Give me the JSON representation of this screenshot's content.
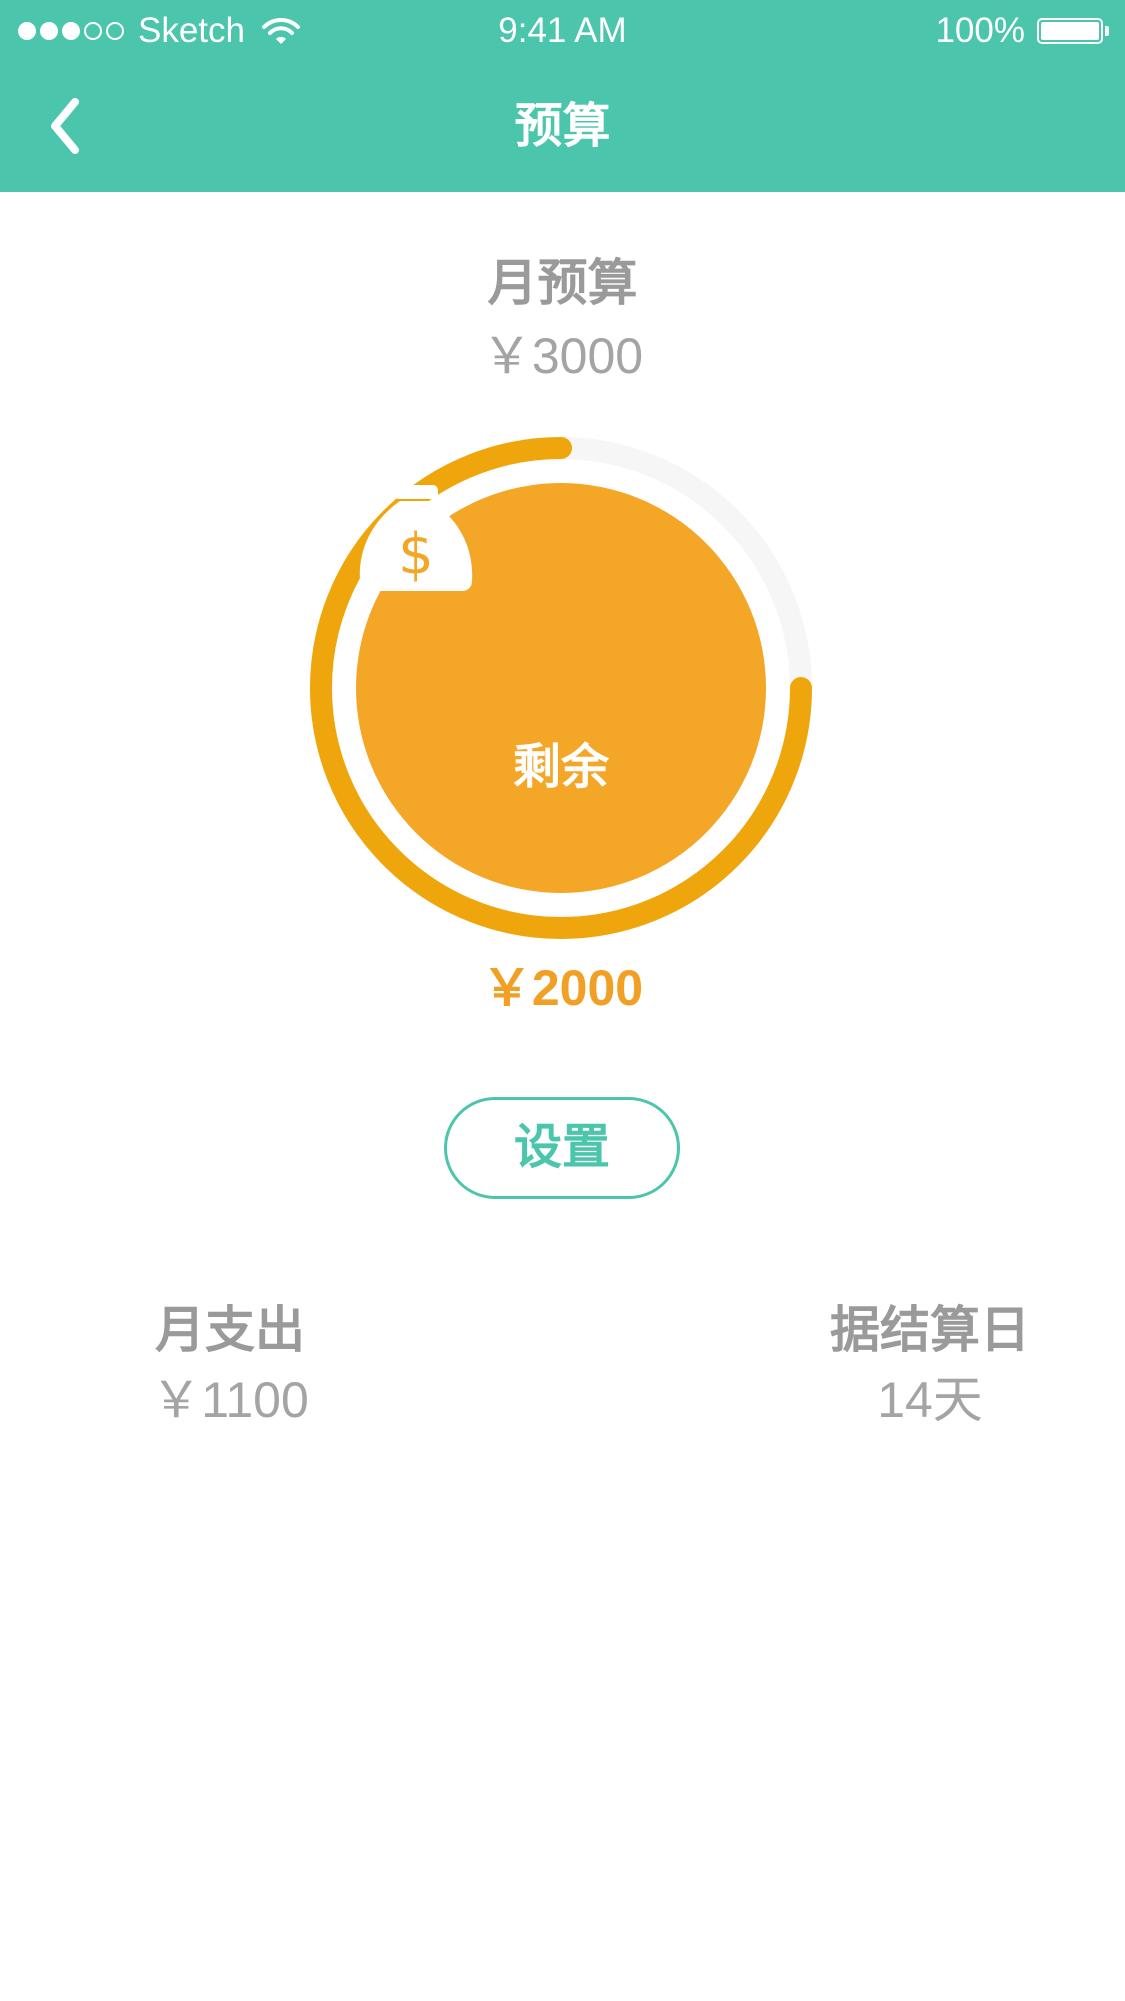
{
  "status_bar": {
    "carrier": "Sketch",
    "time": "9:41 AM",
    "battery_percent": "100%",
    "signal_bars_filled": 3,
    "signal_bars_total": 5
  },
  "nav": {
    "title": "预算",
    "back_icon": "chevron-left-icon"
  },
  "budget": {
    "label": "月预算",
    "amount": "￥3000"
  },
  "ring": {
    "progress_fraction": 0.75,
    "inner_label": "剩余",
    "icon": "moneybag-icon"
  },
  "remaining": {
    "amount": "￥2000"
  },
  "settings_button": {
    "label": "设置"
  },
  "stats": {
    "spending": {
      "label": "月支出",
      "value": "￥1100"
    },
    "settlement": {
      "label": "据结算日",
      "value": "14天"
    }
  },
  "colors": {
    "header": "#4bc5ab",
    "accent_teal": "#4bc5ab",
    "ring_progress": "#efa60c",
    "ring_track": "#f6f6f6",
    "inner_circle": "#f4a626",
    "remaining_text": "#f2a025",
    "gray_text": "#9a9a9a"
  }
}
